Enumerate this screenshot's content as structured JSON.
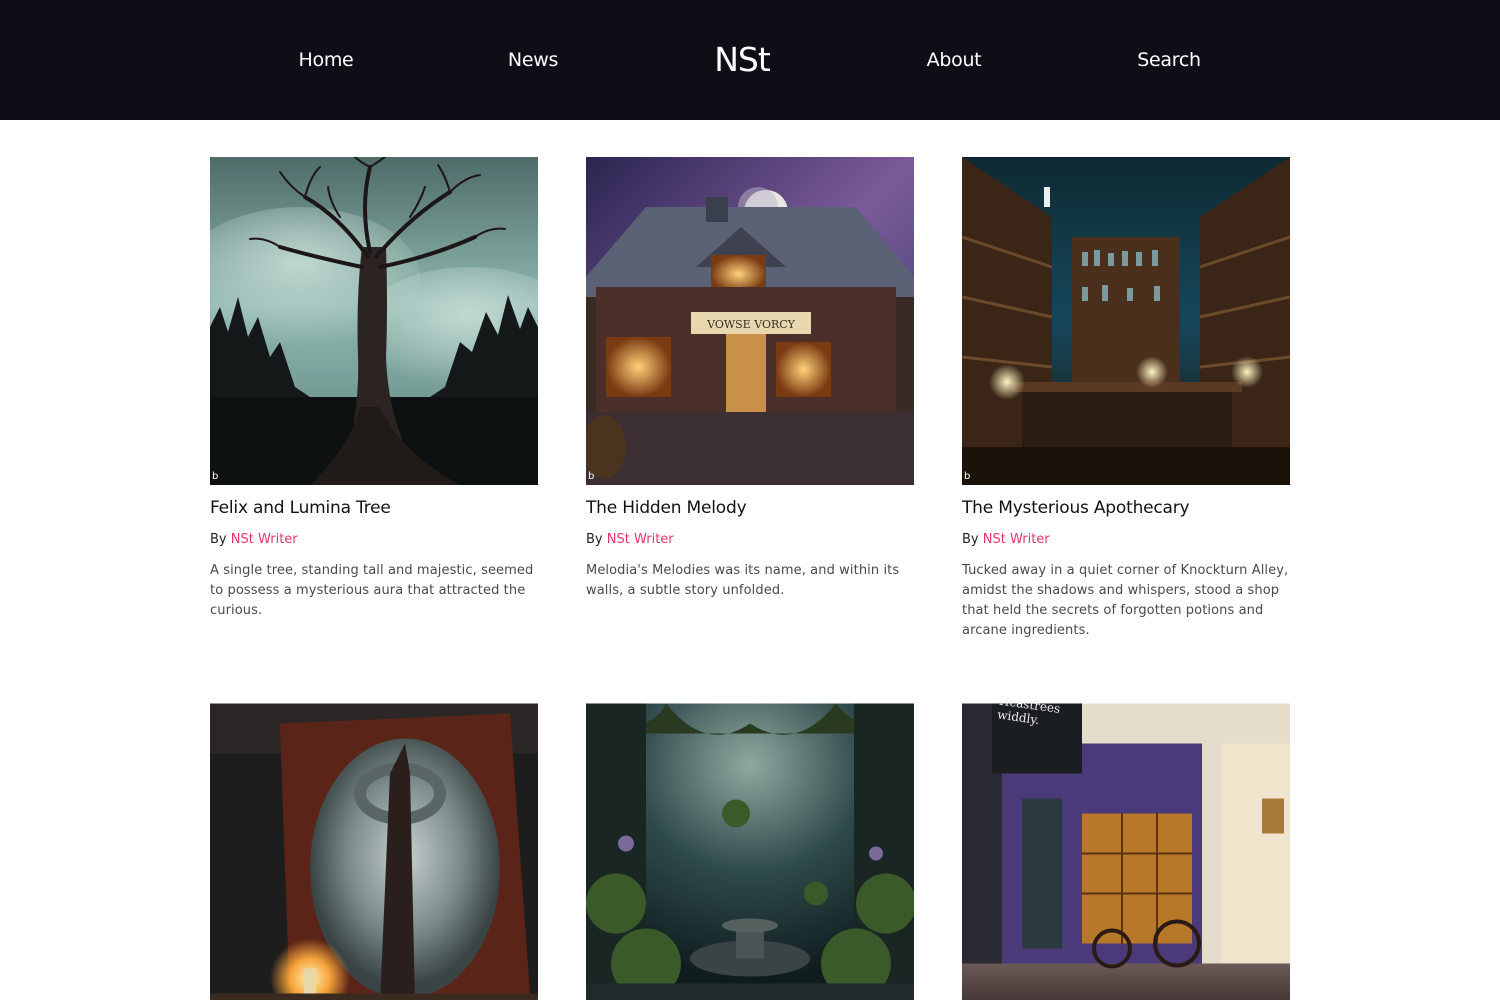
{
  "nav": {
    "home": "Home",
    "news": "News",
    "logo": "NSt",
    "about": "About",
    "search": "Search"
  },
  "byline_prefix": "By",
  "posts": [
    {
      "title": "Felix and Lumina Tree",
      "author": "NSt Writer",
      "excerpt": "A single tree, standing tall and majestic, seemed to possess a mysterious aura that attracted the curious.",
      "image": "giant-tree-forest-image"
    },
    {
      "title": "The Hidden Melody",
      "author": "NSt Writer",
      "excerpt": "Melodia's Melodies was its name, and within its walls, a subtle story unfolded.",
      "image": "music-shop-night-image",
      "sign_text": "VOWSE VORCY"
    },
    {
      "title": "The Mysterious Apothecary",
      "author": "NSt Writer",
      "excerpt": "Tucked away in a quiet corner of Knockturn Alley, amidst the shadows and whispers, stood a shop that held the secrets of forgotten potions and arcane ingredients.",
      "image": "apothecary-interior-image"
    },
    {
      "image": "mirror-candle-image"
    },
    {
      "image": "overgrown-fountain-image"
    },
    {
      "image": "alley-shopfront-image",
      "sign_text": "Hcastrees widdly."
    }
  ],
  "colors": {
    "header_bg": "#0f0e17",
    "author_link": "#e8336d",
    "title_text": "#121212"
  }
}
